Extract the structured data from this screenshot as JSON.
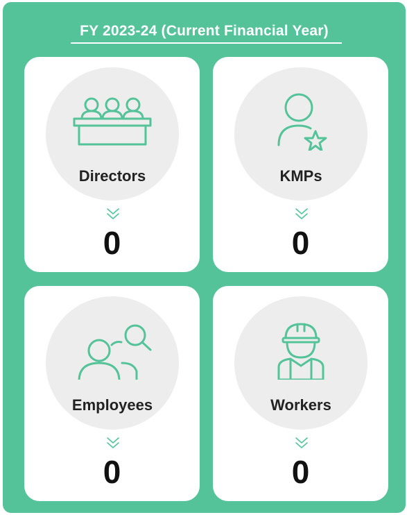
{
  "header": {
    "title": "FY 2023-24 (Current Financial Year)"
  },
  "colors": {
    "panel": "#55c39a",
    "icon_stroke": "#55c39a",
    "circle": "#ededed"
  },
  "cards": [
    {
      "label": "Directors",
      "value": "0",
      "icon": "directors-icon"
    },
    {
      "label": "KMPs",
      "value": "0",
      "icon": "kmp-icon"
    },
    {
      "label": "Employees",
      "value": "0",
      "icon": "employees-icon"
    },
    {
      "label": "Workers",
      "value": "0",
      "icon": "workers-icon"
    }
  ]
}
